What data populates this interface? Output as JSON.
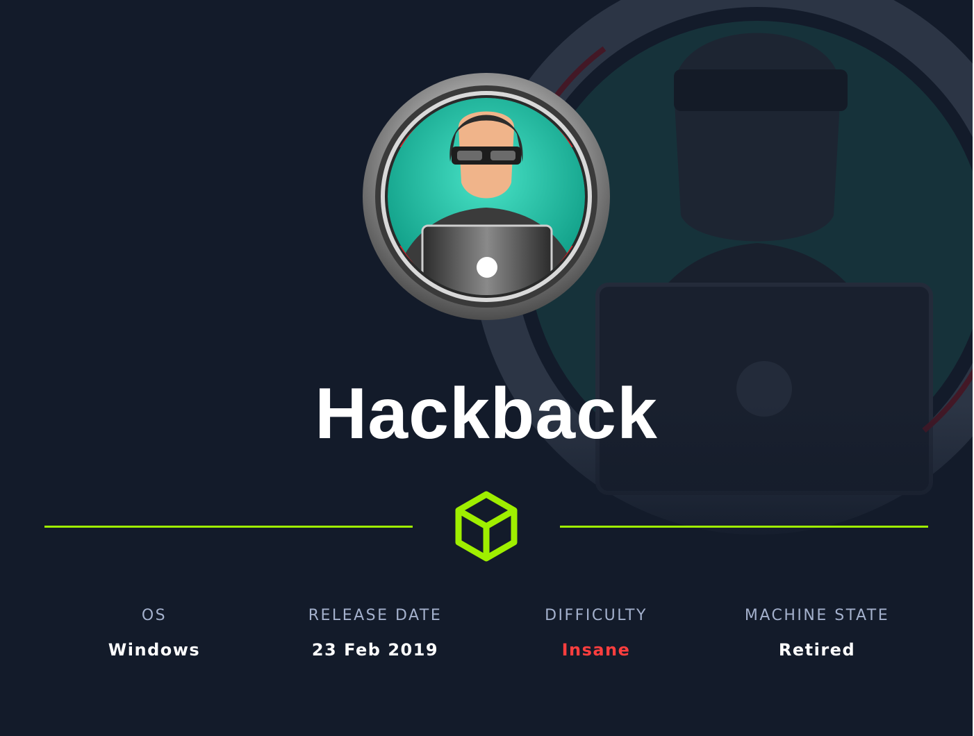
{
  "machine": {
    "name": "Hackback"
  },
  "stats": [
    {
      "label": "OS",
      "value": "Windows"
    },
    {
      "label": "RELEASE DATE",
      "value": "23 Feb 2019"
    },
    {
      "label": "DIFFICULTY",
      "value": "Insane"
    },
    {
      "label": "MACHINE STATE",
      "value": "Retired"
    }
  ],
  "colors": {
    "background": "#131b2a",
    "accent": "#9fef00",
    "difficulty_insane": "#ff3e3e",
    "label": "#a4b1cd"
  },
  "icons": {
    "avatar": "hacker-avatar-icon",
    "logo": "hackthebox-cube-icon"
  }
}
